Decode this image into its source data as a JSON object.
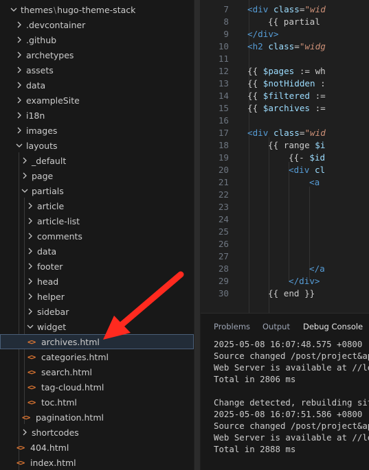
{
  "explorer": {
    "root": {
      "parent": "themes",
      "name": "hugo-theme-stack"
    },
    "items": [
      {
        "label": ".devcontainer",
        "kind": "folder",
        "open": false
      },
      {
        "label": ".github",
        "kind": "folder",
        "open": false
      },
      {
        "label": "archetypes",
        "kind": "folder",
        "open": false
      },
      {
        "label": "assets",
        "kind": "folder",
        "open": false
      },
      {
        "label": "data",
        "kind": "folder",
        "open": false
      },
      {
        "label": "exampleSite",
        "kind": "folder",
        "open": false
      },
      {
        "label": "i18n",
        "kind": "folder",
        "open": false
      },
      {
        "label": "images",
        "kind": "folder",
        "open": false
      },
      {
        "label": "layouts",
        "kind": "folder",
        "open": true
      },
      {
        "label": "_default",
        "kind": "folder",
        "open": false
      },
      {
        "label": "page",
        "kind": "folder",
        "open": false
      },
      {
        "label": "partials",
        "kind": "folder",
        "open": true
      },
      {
        "label": "article",
        "kind": "folder",
        "open": false
      },
      {
        "label": "article-list",
        "kind": "folder",
        "open": false
      },
      {
        "label": "comments",
        "kind": "folder",
        "open": false
      },
      {
        "label": "data",
        "kind": "folder",
        "open": false
      },
      {
        "label": "footer",
        "kind": "folder",
        "open": false
      },
      {
        "label": "head",
        "kind": "folder",
        "open": false
      },
      {
        "label": "helper",
        "kind": "folder",
        "open": false
      },
      {
        "label": "sidebar",
        "kind": "folder",
        "open": false
      },
      {
        "label": "widget",
        "kind": "folder",
        "open": true
      },
      {
        "label": "archives.html",
        "kind": "file",
        "selected": true
      },
      {
        "label": "categories.html",
        "kind": "file"
      },
      {
        "label": "search.html",
        "kind": "file"
      },
      {
        "label": "tag-cloud.html",
        "kind": "file"
      },
      {
        "label": "toc.html",
        "kind": "file"
      },
      {
        "label": "pagination.html",
        "kind": "file"
      },
      {
        "label": "shortcodes",
        "kind": "folder",
        "open": false
      },
      {
        "label": "404.html",
        "kind": "file"
      },
      {
        "label": "index.html",
        "kind": "file"
      }
    ],
    "file_icon": "<>"
  },
  "editor": {
    "lines": [
      {
        "n": "7",
        "code": "<div class=\"wid"
      },
      {
        "n": "8",
        "code": "{{ partial"
      },
      {
        "n": "9",
        "code": "</div>"
      },
      {
        "n": "10",
        "code": "<h2 class=\"widg"
      },
      {
        "n": "11",
        "code": ""
      },
      {
        "n": "12",
        "code": "{{ $pages := wh"
      },
      {
        "n": "13",
        "code": "{{ $notHidden :"
      },
      {
        "n": "14",
        "code": "{{ $filtered :="
      },
      {
        "n": "15",
        "code": "{{ $archives :="
      },
      {
        "n": "16",
        "code": ""
      },
      {
        "n": "17",
        "code": "<div class=\"wid"
      },
      {
        "n": "18",
        "code": "{{ range $i"
      },
      {
        "n": "19",
        "code": "{{- $id"
      },
      {
        "n": "20",
        "code": "<div cl"
      },
      {
        "n": "21",
        "code": "<a"
      },
      {
        "n": "22",
        "code": ""
      },
      {
        "n": "23",
        "code": ""
      },
      {
        "n": "24",
        "code": ""
      },
      {
        "n": "25",
        "code": ""
      },
      {
        "n": "26",
        "code": ""
      },
      {
        "n": "27",
        "code": ""
      },
      {
        "n": "28",
        "code": "</a"
      },
      {
        "n": "29",
        "code": "</div>"
      },
      {
        "n": "30",
        "code": "{{ end }}"
      }
    ]
  },
  "panel": {
    "tabs": [
      "Problems",
      "Output",
      "Debug Console"
    ],
    "terminal": [
      "2025-05-08 16:07:48.575 +0800",
      "Source changed /post/project&appl",
      "Web Server is available at //loca",
      "Total in 2806 ms",
      "",
      "Change detected, rebuilding site",
      "2025-05-08 16:07:51.586 +0800",
      "Source changed /post/project&appl",
      "Web Server is available at //loca",
      "Total in 2888 ms"
    ]
  },
  "annotation": {
    "arrow_color": "#ff2a1f"
  }
}
